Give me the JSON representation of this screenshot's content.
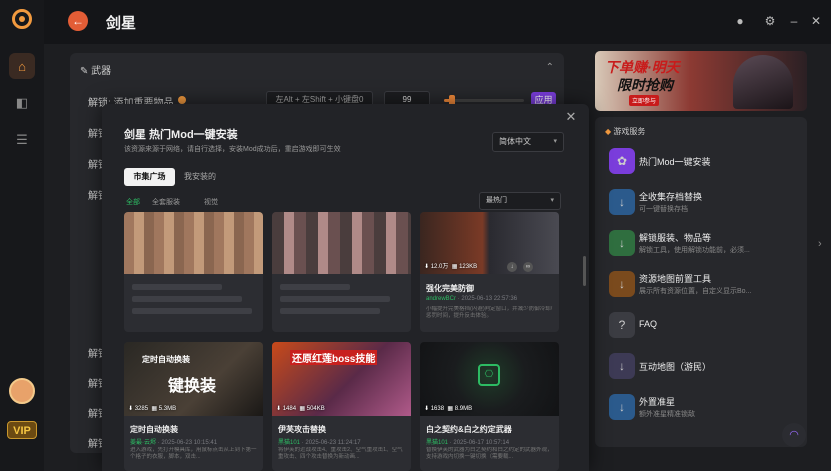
{
  "app": {
    "title": "剑星"
  },
  "sidebar": {
    "vip_label": "VIP"
  },
  "weapons": {
    "header": "武器",
    "row1_label": "解锁: 添加重要物品",
    "row1_hotkey": "左Alt + 左Shift + 小键盘0",
    "row1_value": "99",
    "row1_slider_fraction": 0.1,
    "apply_label": "应用",
    "other_rows_label": "解锁"
  },
  "banner": {
    "line1": "下单赚·明天",
    "line2": "限时抢购",
    "line3": "立即参与"
  },
  "services": {
    "header": "游戏服务",
    "items": [
      {
        "title": "热门Mod一键安装",
        "sub": "",
        "icon": "mod-icon",
        "color": "#7a3ddb"
      },
      {
        "title": "全收集存档替换",
        "sub": "可一键替换存档",
        "icon": "download-icon",
        "color": "#2b5a8c"
      },
      {
        "title": "解锁服装、物品等",
        "sub": "解锁工具，使用解锁功能前，必须...",
        "icon": "download-icon",
        "color": "#2f6e3f"
      },
      {
        "title": "资源地图前置工具",
        "sub": "展示所有资源位置，自定义显示Bo...",
        "icon": "download-icon",
        "color": "#7a4a1d"
      },
      {
        "title": "FAQ",
        "sub": "",
        "icon": "faq-icon",
        "color": "#3b3c42"
      },
      {
        "title": "互动地图（游民）",
        "sub": "",
        "icon": "download-icon",
        "color": "#3d3a55"
      },
      {
        "title": "外置准星",
        "sub": "额外准星精准锁敌",
        "icon": "download-icon",
        "color": "#2b5a8c"
      }
    ]
  },
  "modal": {
    "title": "剑星 热门Mod一键安装",
    "desc": "该资源来源于网络，请自行选择，安装Mod成功后，重启游戏即可生效",
    "language": "简体中文",
    "tabs": [
      "市集广场",
      "我安装的"
    ],
    "filters": [
      "全部",
      "全套服装",
      "视觉"
    ],
    "sort": "最热门",
    "cards": [
      {
        "name": "",
        "author": "",
        "date": "",
        "text": "",
        "views": "",
        "size": ""
      },
      {
        "name": "",
        "author": "",
        "date": "",
        "text": "",
        "views": "",
        "size": ""
      },
      {
        "name": "强化完美防御",
        "author": "andrewBCr",
        "date": "2025-06-13 22:57:36",
        "text": "小幅提升完美格挡(闪避)判定窗口，并减少防御冷却/惩罚时间，提升反击体验。",
        "views": "12.0万",
        "size": "123KB"
      },
      {
        "name": "定时自动换装",
        "author": "姜最·云烬",
        "date": "2025-06-23 10:15:41",
        "text": "进入游戏，先打开模具库，用鼠标点击从上到下第一个格子的衣服，脚本，双击...",
        "views": "3285",
        "size": "5.3MB",
        "overlay1": "定时自动换装",
        "overlay2": "键换装"
      },
      {
        "name": "伊芙攻击替换",
        "author": "黑猫101",
        "date": "2025-06-23 11:24:17",
        "text": "将伊芙的近战攻击4、重攻击2、空气重攻击1、空气重攻击、四个攻击替换为新动画...",
        "views": "1484",
        "size": "504KB",
        "overlay1": "还原红莲boss技能"
      },
      {
        "name": "白之契约&白之约定武器",
        "author": "黑猫101",
        "date": "2025-06-17 10:57:14",
        "text": "替换伊芙的武器为白之契约和白之约定的武器外观，支持游戏内切换一键切换（需要载...",
        "views": "1638",
        "size": "8.9MB"
      }
    ]
  }
}
